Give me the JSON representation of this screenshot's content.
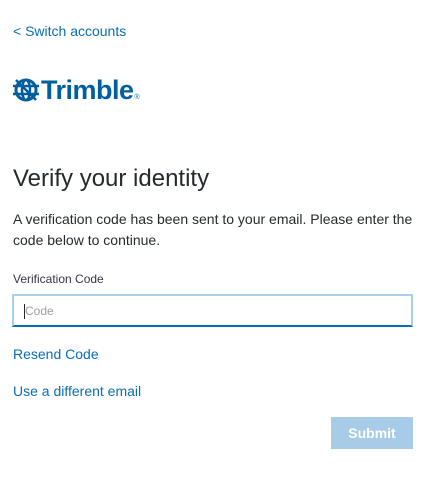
{
  "nav": {
    "switch_accounts_label": "< Switch accounts"
  },
  "logo": {
    "text": "Trimble",
    "registered_mark": "®",
    "icon": "trimble-globe-icon",
    "brand_color": "#005f9e"
  },
  "main": {
    "title": "Verify your identity",
    "description": "A verification code has been sent to your email. Please enter the code below to continue.",
    "field_label": "Verification Code",
    "field_placeholder": "Code",
    "field_value": "",
    "resend_label": "Resend Code",
    "different_email_label": "Use a different email",
    "submit_label": "Submit"
  },
  "colors": {
    "link": "#0a6eb4",
    "text": "#252a2e",
    "submit_disabled_bg": "#a8cce8"
  }
}
